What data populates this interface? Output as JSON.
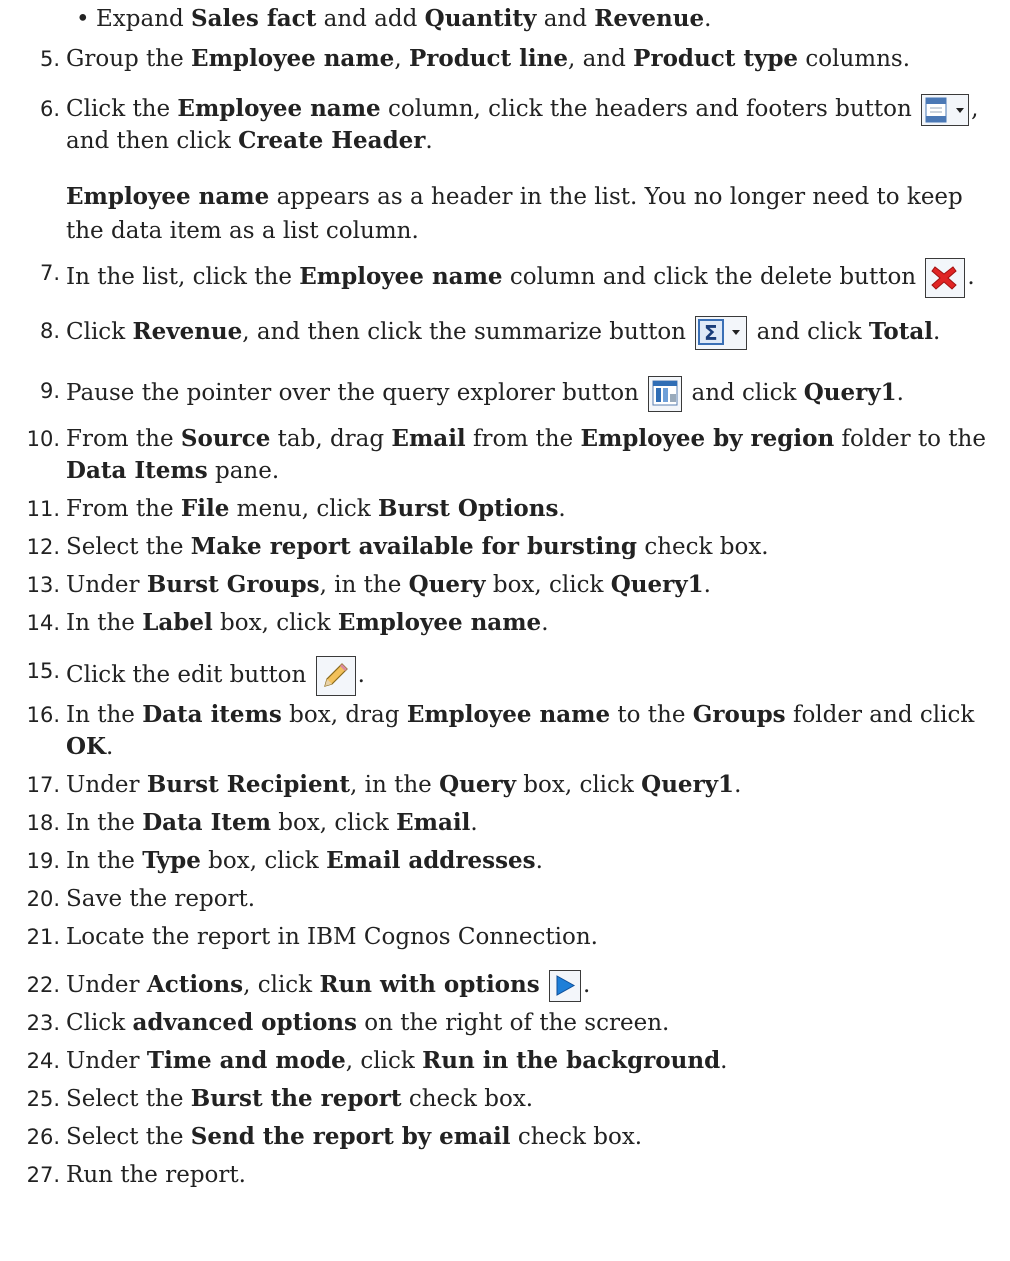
{
  "steps": [
    {
      "kind": "bullet",
      "parts": [
        [
          "Expand ",
          0
        ],
        [
          "Sales fact",
          1
        ],
        [
          " and add ",
          0
        ],
        [
          "Quantity",
          1
        ],
        [
          " and ",
          0
        ],
        [
          "Revenue",
          1
        ],
        [
          ".",
          0
        ]
      ]
    },
    {
      "num": "5.",
      "parts": [
        [
          "Group the ",
          0
        ],
        [
          "Employee name",
          1
        ],
        [
          ", ",
          0
        ],
        [
          "Product line",
          1
        ],
        [
          ", and ",
          0
        ],
        [
          "Product type",
          1
        ],
        [
          " columns.",
          0
        ]
      ]
    },
    {
      "num": "6.",
      "parts": [
        [
          "Click the ",
          0
        ],
        [
          "Employee name",
          1
        ],
        [
          " column, click the headers and footers button ",
          0
        ]
      ],
      "icon": "header-footer-icon",
      "after": [
        [
          ",",
          0
        ]
      ]
    },
    {
      "kind": "cont",
      "parts": [
        [
          "and then click ",
          0
        ],
        [
          "Create Header",
          1
        ],
        [
          ".",
          0
        ]
      ]
    },
    {
      "kind": "note",
      "parts": [
        [
          "Employee name",
          1
        ],
        [
          " appears as a header in the list. You no longer need to keep the data item as a list column.",
          0
        ]
      ]
    },
    {
      "num": "7.",
      "parts": [
        [
          "In the list, click the ",
          0
        ],
        [
          "Employee name",
          1
        ],
        [
          " column and click the delete button ",
          0
        ]
      ],
      "icon": "delete-icon",
      "after": [
        [
          ".",
          0
        ]
      ]
    },
    {
      "num": "8.",
      "parts": [
        [
          "Click ",
          0
        ],
        [
          "Revenue",
          1
        ],
        [
          ", and then click the summarize button ",
          0
        ]
      ],
      "icon": "summarize-icon",
      "after": [
        [
          " and click ",
          0
        ],
        [
          "Total",
          1
        ],
        [
          ".",
          0
        ]
      ]
    },
    {
      "num": "9.",
      "parts": [
        [
          "Pause the pointer over the query explorer button ",
          0
        ]
      ],
      "icon": "query-explorer-icon",
      "after": [
        [
          " and click ",
          0
        ],
        [
          "Query1",
          1
        ],
        [
          ".",
          0
        ]
      ]
    },
    {
      "num": "10.",
      "parts": [
        [
          "From the ",
          0
        ],
        [
          "Source",
          1
        ],
        [
          " tab, drag ",
          0
        ],
        [
          "Email",
          1
        ],
        [
          " from the ",
          0
        ],
        [
          "Employee by region",
          1
        ],
        [
          " folder to the",
          0
        ]
      ]
    },
    {
      "kind": "cont",
      "parts": [
        [
          "Data Items",
          1
        ],
        [
          " pane.",
          0
        ]
      ]
    },
    {
      "num": "11.",
      "parts": [
        [
          "From the ",
          0
        ],
        [
          "File",
          1
        ],
        [
          " menu, click ",
          0
        ],
        [
          "Burst Options",
          1
        ],
        [
          ".",
          0
        ]
      ]
    },
    {
      "num": "12.",
      "parts": [
        [
          "Select the ",
          0
        ],
        [
          "Make report available for bursting",
          1
        ],
        [
          " check box.",
          0
        ]
      ]
    },
    {
      "num": "13.",
      "parts": [
        [
          "Under ",
          0
        ],
        [
          "Burst Groups",
          1
        ],
        [
          ", in the ",
          0
        ],
        [
          "Query",
          1
        ],
        [
          " box, click ",
          0
        ],
        [
          "Query1",
          1
        ],
        [
          ".",
          0
        ]
      ]
    },
    {
      "num": "14.",
      "parts": [
        [
          "In the ",
          0
        ],
        [
          "Label",
          1
        ],
        [
          " box, click ",
          0
        ],
        [
          "Employee name",
          1
        ],
        [
          ".",
          0
        ]
      ]
    },
    {
      "num": "15.",
      "parts": [
        [
          "Click the edit button ",
          0
        ]
      ],
      "icon": "edit-icon",
      "after": [
        [
          ".",
          0
        ]
      ]
    },
    {
      "num": "16.",
      "parts": [
        [
          "In the ",
          0
        ],
        [
          "Data items",
          1
        ],
        [
          " box, drag ",
          0
        ],
        [
          "Employee name",
          1
        ],
        [
          " to the ",
          0
        ],
        [
          "Groups",
          1
        ],
        [
          " folder and click",
          0
        ]
      ]
    },
    {
      "kind": "cont",
      "parts": [
        [
          "OK",
          1
        ],
        [
          ".",
          0
        ]
      ]
    },
    {
      "num": "17.",
      "parts": [
        [
          "Under ",
          0
        ],
        [
          "Burst Recipient",
          1
        ],
        [
          ", in the ",
          0
        ],
        [
          "Query",
          1
        ],
        [
          " box, click ",
          0
        ],
        [
          "Query1",
          1
        ],
        [
          ".",
          0
        ]
      ]
    },
    {
      "num": "18.",
      "parts": [
        [
          "In the ",
          0
        ],
        [
          "Data Item",
          1
        ],
        [
          " box, click ",
          0
        ],
        [
          "Email",
          1
        ],
        [
          ".",
          0
        ]
      ]
    },
    {
      "num": "19.",
      "parts": [
        [
          "In the ",
          0
        ],
        [
          "Type",
          1
        ],
        [
          " box, click ",
          0
        ],
        [
          "Email addresses",
          1
        ],
        [
          ".",
          0
        ]
      ]
    },
    {
      "num": "20.",
      "parts": [
        [
          "Save the report.",
          0
        ]
      ]
    },
    {
      "num": "21.",
      "parts": [
        [
          "Locate the report in IBM Cognos Connection.",
          0
        ]
      ]
    },
    {
      "num": "22.",
      "parts": [
        [
          "Under ",
          0
        ],
        [
          "Actions",
          1
        ],
        [
          ", click ",
          0
        ],
        [
          "Run with options",
          1
        ],
        [
          " ",
          0
        ]
      ],
      "icon": "run-icon",
      "after": [
        [
          ".",
          0
        ]
      ]
    },
    {
      "num": "23.",
      "parts": [
        [
          "Click ",
          0
        ],
        [
          "advanced options",
          1
        ],
        [
          " on the right of the screen.",
          0
        ]
      ]
    },
    {
      "num": "24.",
      "parts": [
        [
          "Under ",
          0
        ],
        [
          "Time and mode",
          1
        ],
        [
          ", click ",
          0
        ],
        [
          "Run in the background",
          1
        ],
        [
          ".",
          0
        ]
      ]
    },
    {
      "num": "25.",
      "parts": [
        [
          "Select the ",
          0
        ],
        [
          "Burst the report",
          1
        ],
        [
          " check box.",
          0
        ]
      ]
    },
    {
      "num": "26.",
      "parts": [
        [
          "Select the ",
          0
        ],
        [
          "Send the report by email",
          1
        ],
        [
          " check box.",
          0
        ]
      ]
    },
    {
      "num": "27.",
      "parts": [
        [
          "Run the report.",
          0
        ]
      ]
    }
  ]
}
